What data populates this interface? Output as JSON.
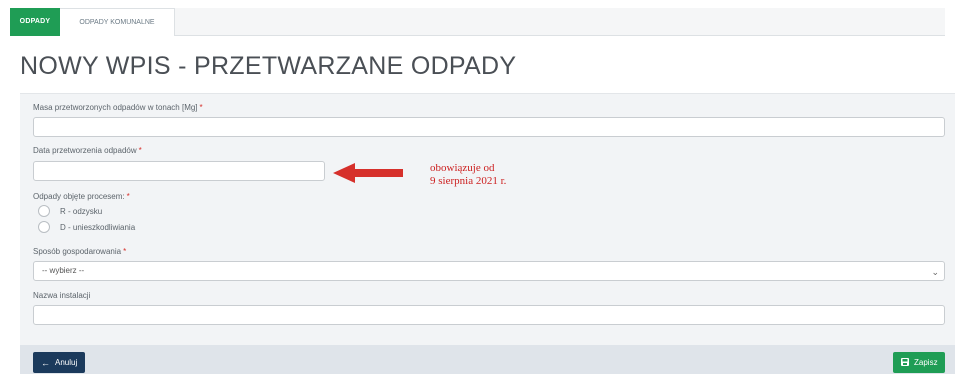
{
  "tabs": [
    {
      "label": "ODPADY",
      "active": true
    },
    {
      "label": "ODPADY KOMUNALNE",
      "active": false
    }
  ],
  "page_title": "NOWY WPIS - PRZETWARZANE ODPADY",
  "required_marker": "*",
  "form": {
    "mass_label": "Masa przetworzonych odpadów w tonach [Mg]",
    "date_label": "Data przetworzenia odpadów",
    "process_label": "Odpady objęte procesem:",
    "process_options": [
      "R - odzysku",
      "D - unieszkodliwiania"
    ],
    "management_label": "Sposób gospodarowania",
    "management_selected": "-- wybierz --",
    "installation_label": "Nazwa instalacji"
  },
  "annotation": {
    "line1": "obowiązuje od",
    "line2": "9 sierpnia 2021 r.",
    "color": "#cc1f1f"
  },
  "buttons": {
    "cancel": "Anuluj",
    "save": "Zapisz"
  },
  "colors": {
    "accent_green": "#1f9d55",
    "cancel_navy": "#1b3a5c",
    "required_red": "#d6302b"
  }
}
